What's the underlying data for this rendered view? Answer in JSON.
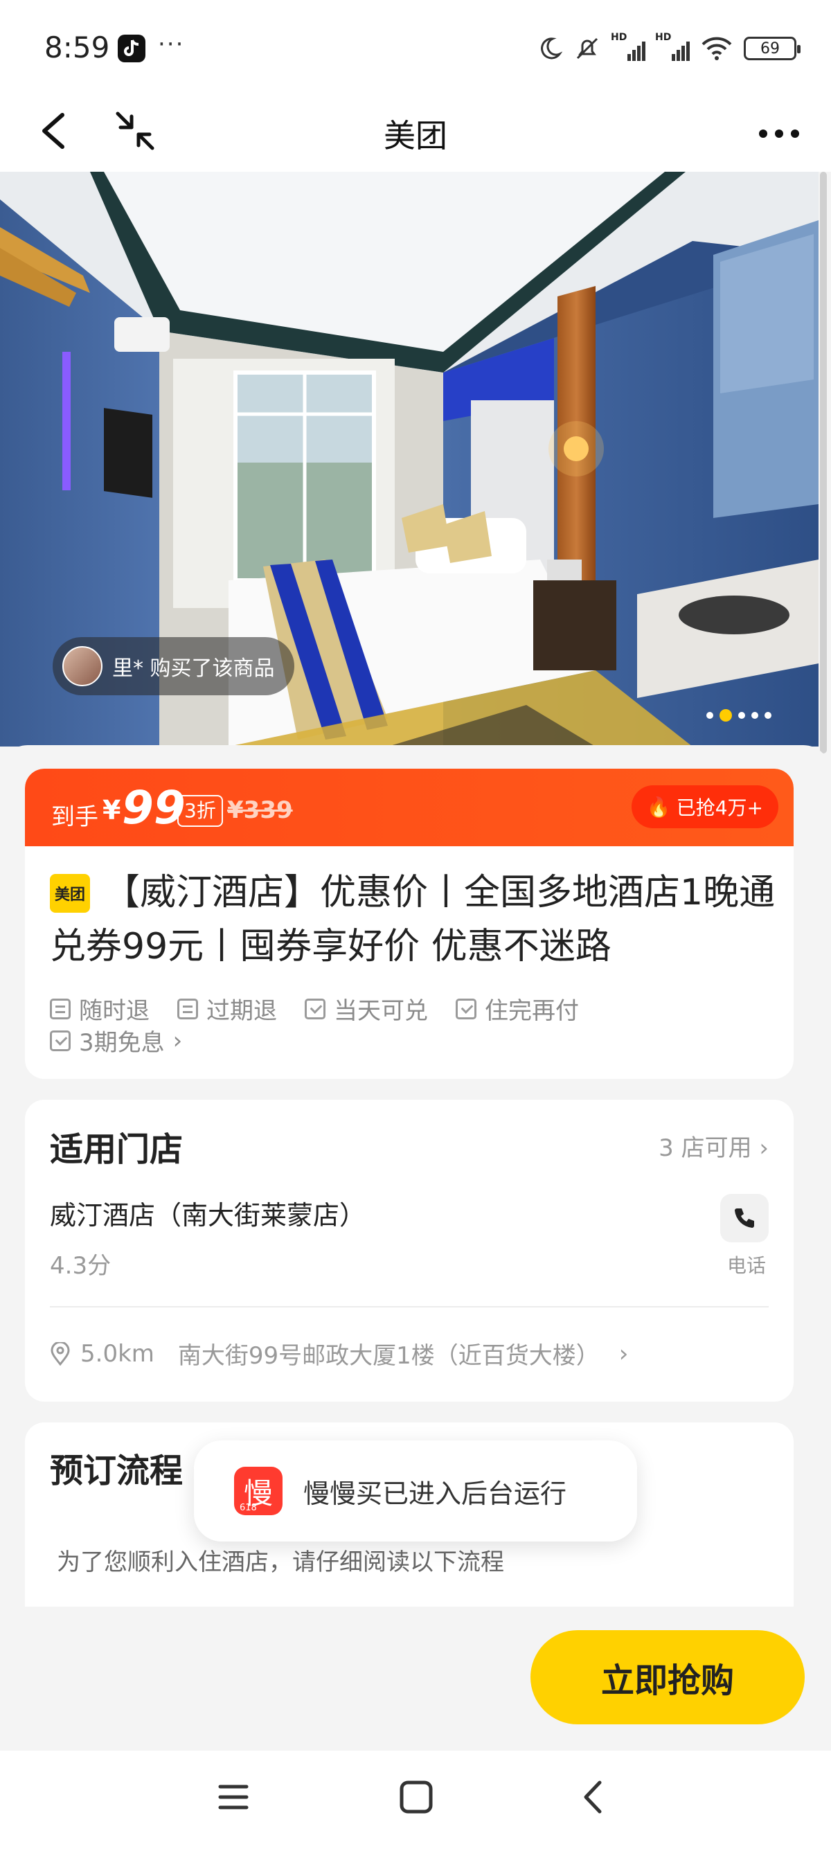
{
  "status_bar": {
    "time": "8:59",
    "dots": "···",
    "battery": "69",
    "icons": [
      "tiktok-icon",
      "moon-icon",
      "mute-icon",
      "signal-hd-icon",
      "signal-hd-icon",
      "wifi-icon",
      "battery-icon"
    ]
  },
  "nav": {
    "title": "美团",
    "icons": [
      "back-icon",
      "shrink-icon",
      "more-icon"
    ]
  },
  "hero": {
    "buyer_text": "里* 购买了该商品",
    "dots_count": 5,
    "active_dot": 2
  },
  "price": {
    "prefix": "到手",
    "currency": "¥",
    "value": "99",
    "discount": "3折",
    "original": "¥339",
    "grabbed": "已抢4万+"
  },
  "product": {
    "logo_text": "美团",
    "title": "【威汀酒店】优惠价丨全国多地酒店1晚通兑券99元丨囤券享好价 优惠不迷路",
    "features_row1": [
      "随时退",
      "过期退",
      "当天可兑",
      "住完再付"
    ],
    "feature_row2": "3期免息",
    "feature_row2_chevron": "›"
  },
  "store": {
    "heading": "适用门店",
    "count": "3 店可用",
    "count_chevron": "›",
    "name": "威汀酒店（南大街莱蒙店）",
    "rating": "4.3分",
    "phone_label": "电话",
    "distance": "5.0km",
    "address": "南大街99号邮政大厦1楼（近百货大楼）",
    "address_chevron": "›"
  },
  "booking": {
    "heading": "预订流程",
    "note": "为了您顺利入住酒店，请仔细阅读以下流程"
  },
  "toast": {
    "icon_char": "慢",
    "icon_sub": "618",
    "text": "慢慢买已进入后台运行"
  },
  "cta": {
    "label": "立即抢购"
  },
  "colors": {
    "accent_orange": "#ff4a17",
    "brand_yellow": "#ffd100"
  }
}
